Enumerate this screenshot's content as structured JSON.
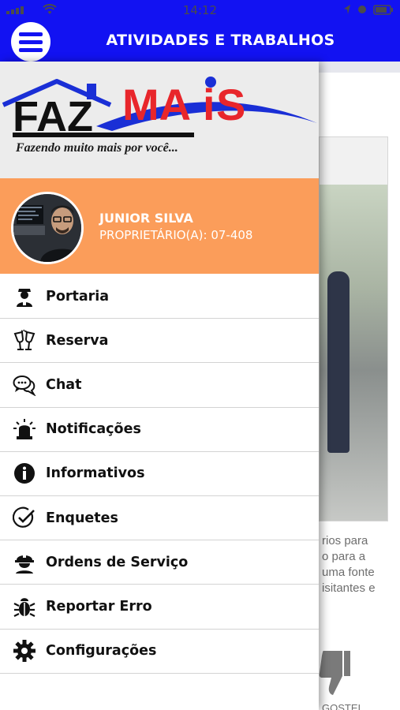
{
  "status_bar": {
    "time": "14:12"
  },
  "header": {
    "title": "ATIVIDADES E TRABALHOS"
  },
  "icons": {
    "menu": "hamburger-icon",
    "portaria": "doorman-icon",
    "reserva": "toast-glasses-icon",
    "chat": "chat-bubbles-icon",
    "notificacoes": "siren-icon",
    "informativos": "info-icon",
    "enquetes": "check-circle-icon",
    "ordens": "worker-helmet-icon",
    "reportar": "bug-icon",
    "configuracoes": "gear-icon"
  },
  "colors": {
    "header_blue": "#1212f2",
    "profile_orange": "#fb9d5a",
    "logo_red": "#e8262b",
    "logo_blue": "#1a2fd6"
  },
  "logo": {
    "word_faz": "FAZ",
    "word_mais_m": "MA",
    "word_mais_i": "i",
    "word_mais_s": "S",
    "tagline": "Fazendo muito mais por você..."
  },
  "profile": {
    "name": "JUNIOR SILVA",
    "role": "PROPRIETÁRIO(A): 07-408"
  },
  "menu": [
    {
      "label": "Portaria"
    },
    {
      "label": "Reserva"
    },
    {
      "label": "Chat"
    },
    {
      "label": "Notificações"
    },
    {
      "label": "Informativos"
    },
    {
      "label": "Enquetes"
    },
    {
      "label": "Ordens de Serviço"
    },
    {
      "label": "Reportar Erro"
    },
    {
      "label": "Configurações"
    }
  ],
  "background": {
    "text_lines": [
      "rios para",
      "o para a",
      "uma fonte",
      "isitantes e"
    ],
    "footer_text": "GOSTEI"
  }
}
